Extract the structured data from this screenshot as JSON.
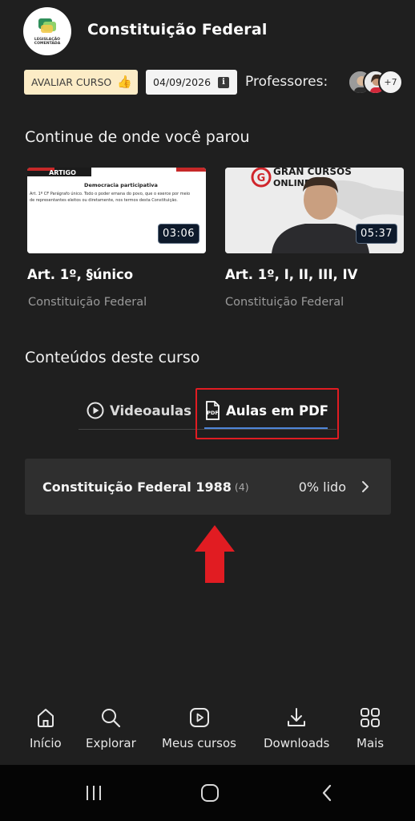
{
  "header": {
    "logo_text": "LEGISLAÇÃO COMENTADA",
    "title": "Constituição Federal"
  },
  "meta": {
    "rate_label": "AVALIAR CURSO",
    "date": "04/09/2026",
    "professors_label": "Professores:",
    "professors_more": "+7"
  },
  "continue_section": {
    "title": "Continue de onde você parou",
    "videos": [
      {
        "title": "Art. 1º, §único",
        "subtitle": "Constituição Federal",
        "duration": "03:06",
        "thumb_banner": "ARTIGO",
        "thumb_heading": "Democracia participativa",
        "thumb_text": "Art. 1º CF Parágrafo único. Todo o poder emana do povo, que o exerce por meio de representantes eleitos ou diretamente, nos termos desta Constituição."
      },
      {
        "title": "Art. 1º, I, II, III, IV",
        "subtitle": "Constituição Federal",
        "duration": "05:37",
        "thumb_brand_top": "GRAN CURSOS",
        "thumb_brand_bottom": "ONLINE"
      }
    ]
  },
  "contents_section": {
    "title": "Conteúdos deste curso",
    "tabs": [
      {
        "label": "Videoaulas",
        "icon": "play-circle-icon",
        "active": false
      },
      {
        "label": "Aulas em PDF",
        "icon": "pdf-file-icon",
        "active": true
      }
    ],
    "pdf_items": [
      {
        "title": "Constituição Federal 1988",
        "count": "(4)",
        "progress": "0% lido"
      }
    ]
  },
  "bottom_nav": [
    {
      "label": "Início",
      "icon": "home-icon"
    },
    {
      "label": "Explorar",
      "icon": "search-icon"
    },
    {
      "label": "Meus cursos",
      "icon": "play-square-icon"
    },
    {
      "label": "Downloads",
      "icon": "download-icon"
    },
    {
      "label": "Mais",
      "icon": "grid-icon"
    }
  ],
  "colors": {
    "background": "#1f1f1f",
    "rate_button_bg": "#fcecc6",
    "tab_underline": "#4f86d9",
    "annotation_red": "#e11c22"
  }
}
